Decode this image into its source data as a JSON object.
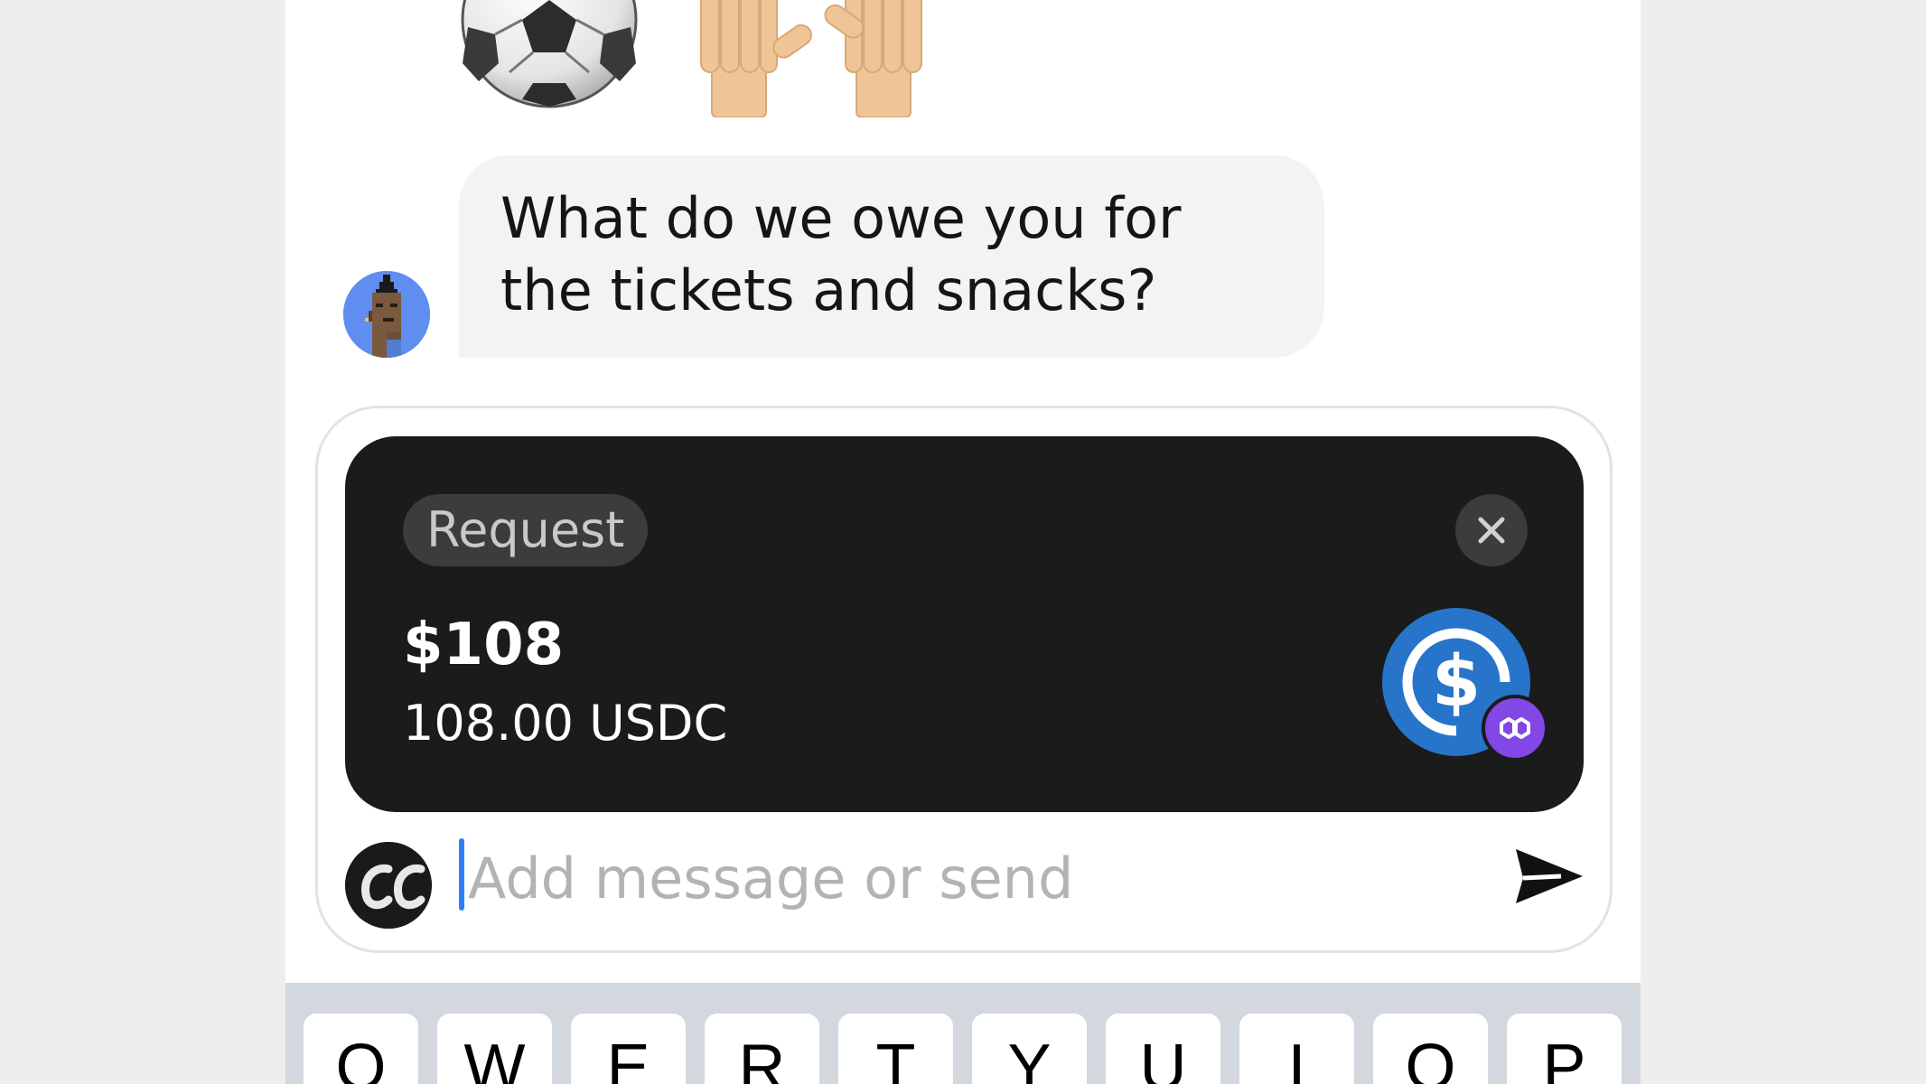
{
  "conversation": {
    "emojis": [
      {
        "name": "soccer-ball"
      },
      {
        "name": "raising-hands"
      }
    ],
    "incoming_message": {
      "text": "What do we owe you for the tickets and snacks?"
    }
  },
  "composer": {
    "request_card": {
      "chip_label": "Request",
      "amount": "$108",
      "token_amount": "108.00 USDC",
      "token_icon": "usdc-icon",
      "network_icon": "polygon-icon",
      "close_icon": "close-icon"
    },
    "input": {
      "placeholder": "Add message or send",
      "value": ""
    },
    "send_icon": "send-icon"
  },
  "keyboard": {
    "row1": [
      "Q",
      "W",
      "E",
      "R",
      "T",
      "Y",
      "U",
      "I",
      "O",
      "P"
    ]
  },
  "colors": {
    "card_bg": "#1b1b1b",
    "bubble_bg": "#f3f3f3",
    "usdc_blue": "#2775ca",
    "polygon_purple": "#8247e5",
    "caret_blue": "#2d7ff9"
  }
}
